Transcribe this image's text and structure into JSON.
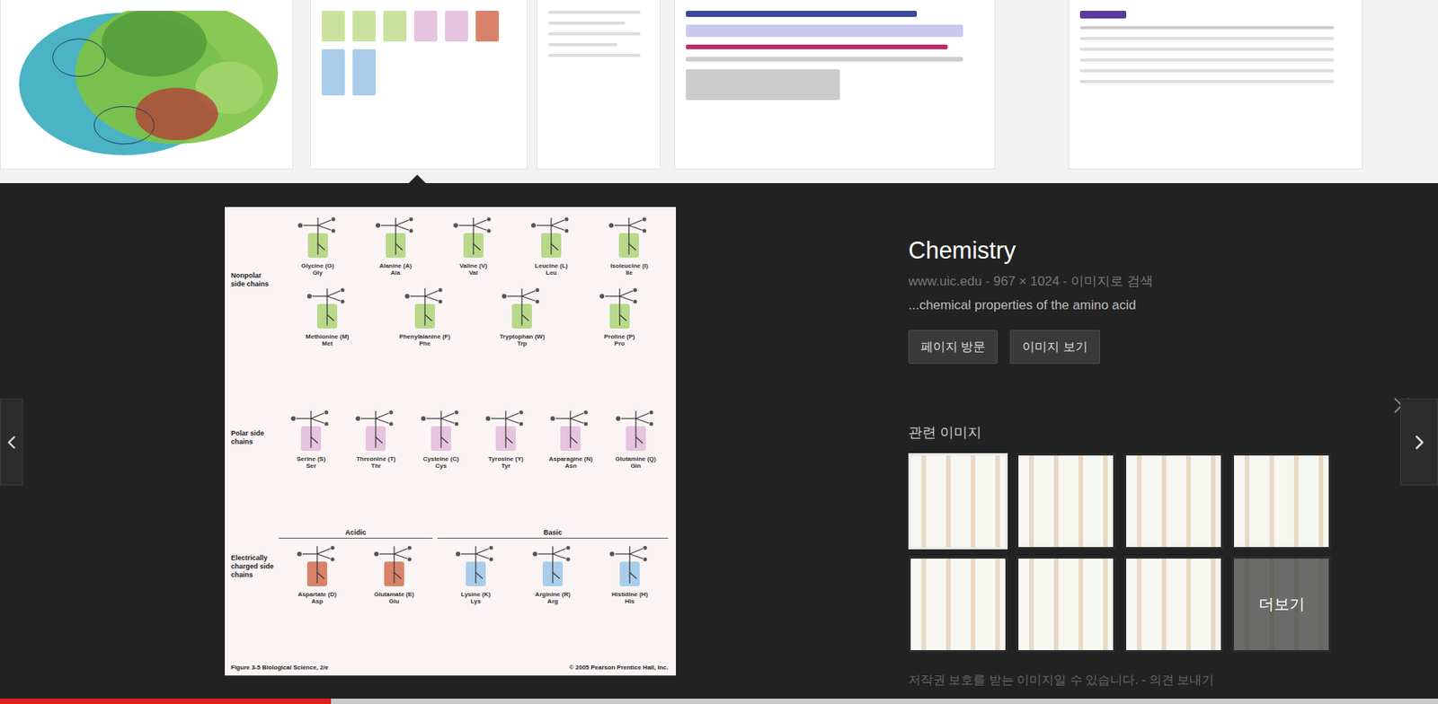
{
  "preview": {
    "title": "Chemistry",
    "source": "www.uic.edu - 967 × 1024 - 이미지로 검색",
    "snippet": "...chemical properties of the amino acid",
    "buttons": [
      "페이지 방문",
      "이미지 보기"
    ],
    "related_label": "관련 이미지",
    "related": [
      {
        "selected": true
      },
      {
        "selected": false
      },
      {
        "selected": false
      },
      {
        "selected": false
      },
      {
        "selected": false
      },
      {
        "selected": false
      },
      {
        "selected": false
      },
      {
        "selected": false
      }
    ],
    "more": "더보기",
    "footer": "저작권 보호를 받는 이미지일 수 있습니다. - 의견 보내기"
  },
  "figure": {
    "groups": [
      {
        "label": "Nonpolar side chains",
        "subgroups": [
          {
            "label": "",
            "items": [
              {
                "name": "Glycine (G)",
                "abbr": "Gly",
                "color": "#b8d98a"
              },
              {
                "name": "Alanine (A)",
                "abbr": "Ala",
                "color": "#b8d98a"
              },
              {
                "name": "Valine (V)",
                "abbr": "Val",
                "color": "#b8d98a"
              },
              {
                "name": "Leucine (L)",
                "abbr": "Leu",
                "color": "#b8d98a"
              },
              {
                "name": "Isoleucine (I)",
                "abbr": "Ile",
                "color": "#b8d98a"
              }
            ]
          },
          {
            "label": "",
            "items": [
              {
                "name": "Methionine (M)",
                "abbr": "Met",
                "color": "#b8d98a"
              },
              {
                "name": "Phenylalanine (F)",
                "abbr": "Phe",
                "color": "#b8d98a"
              },
              {
                "name": "Tryptophan (W)",
                "abbr": "Trp",
                "color": "#b8d98a"
              },
              {
                "name": "Proline (P)",
                "abbr": "Pro",
                "color": "#b8d98a"
              }
            ]
          }
        ]
      },
      {
        "label": "Polar side chains",
        "subgroups": [
          {
            "label": "",
            "items": [
              {
                "name": "Serine (S)",
                "abbr": "Ser",
                "color": "#e6c3de"
              },
              {
                "name": "Threonine (T)",
                "abbr": "Thr",
                "color": "#e6c3de"
              },
              {
                "name": "Cysteine (C)",
                "abbr": "Cys",
                "color": "#e6c3de"
              },
              {
                "name": "Tyrosine (Y)",
                "abbr": "Tyr",
                "color": "#e6c3de"
              },
              {
                "name": "Asparagine (N)",
                "abbr": "Asn",
                "color": "#e6c3de"
              },
              {
                "name": "Glutamine (Q)",
                "abbr": "Gln",
                "color": "#e6c3de"
              }
            ]
          }
        ]
      },
      {
        "label": "Electrically charged side chains",
        "subgroups": [
          {
            "label": "Acidic",
            "items": [
              {
                "name": "Aspartate (D)",
                "abbr": "Asp",
                "color": "#d9826a"
              },
              {
                "name": "Glutamate (E)",
                "abbr": "Glu",
                "color": "#d9826a"
              }
            ]
          },
          {
            "label": "Basic",
            "items": [
              {
                "name": "Lysine (K)",
                "abbr": "Lys",
                "color": "#a9cdea"
              },
              {
                "name": "Arginine (R)",
                "abbr": "Arg",
                "color": "#a9cdea"
              },
              {
                "name": "Histidine (H)",
                "abbr": "His",
                "color": "#a9cdea"
              }
            ]
          }
        ]
      }
    ],
    "caption": "Figure 3-5 Biological Science, 2/e",
    "copyright": "© 2005 Pearson Prentice Hall, Inc."
  },
  "video_progress": {
    "level": 0.23
  }
}
